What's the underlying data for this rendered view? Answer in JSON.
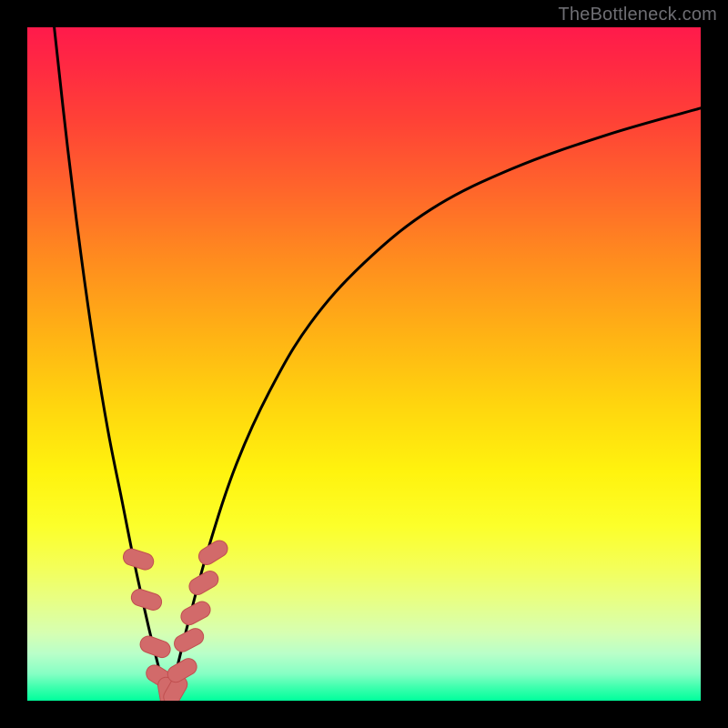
{
  "watermark": {
    "text": "TheBottleneck.com"
  },
  "chart_data": {
    "type": "line",
    "title": "",
    "xlabel": "",
    "ylabel": "",
    "xlim": [
      0,
      100
    ],
    "ylim": [
      0,
      100
    ],
    "grid": false,
    "legend": false,
    "background_gradient": {
      "direction": "vertical",
      "stops": [
        {
          "pos": 0,
          "color": "#ff1a4b"
        },
        {
          "pos": 50,
          "color": "#ffd50e"
        },
        {
          "pos": 80,
          "color": "#f4ff57"
        },
        {
          "pos": 100,
          "color": "#00ff9c"
        }
      ]
    },
    "series": [
      {
        "name": "left-branch",
        "color": "#000000",
        "x": [
          4,
          6,
          8,
          10,
          12,
          14,
          16,
          18,
          19.5,
          20.5
        ],
        "y": [
          100,
          82,
          66,
          52,
          40,
          30,
          20,
          11,
          5,
          1
        ]
      },
      {
        "name": "right-branch",
        "color": "#000000",
        "x": [
          21,
          22,
          24,
          27,
          31,
          36,
          42,
          50,
          60,
          72,
          86,
          100
        ],
        "y": [
          1,
          4,
          12,
          23,
          35,
          46,
          56,
          65,
          73,
          79,
          84,
          88
        ]
      }
    ],
    "markers": {
      "name": "pill-markers",
      "color": "#d26a6a",
      "outline": "#c04f4f",
      "points": [
        {
          "x": 16.5,
          "y": 21,
          "angle": -72
        },
        {
          "x": 17.7,
          "y": 15,
          "angle": -72
        },
        {
          "x": 19.0,
          "y": 8,
          "angle": -70
        },
        {
          "x": 19.8,
          "y": 3.5,
          "angle": -58
        },
        {
          "x": 20.8,
          "y": 1.2,
          "angle": -10
        },
        {
          "x": 22.0,
          "y": 1.5,
          "angle": 30
        },
        {
          "x": 23.0,
          "y": 4.5,
          "angle": 60
        },
        {
          "x": 24.0,
          "y": 9,
          "angle": 62
        },
        {
          "x": 25.0,
          "y": 13,
          "angle": 62
        },
        {
          "x": 26.2,
          "y": 17.5,
          "angle": 60
        },
        {
          "x": 27.6,
          "y": 22,
          "angle": 58
        }
      ]
    }
  }
}
